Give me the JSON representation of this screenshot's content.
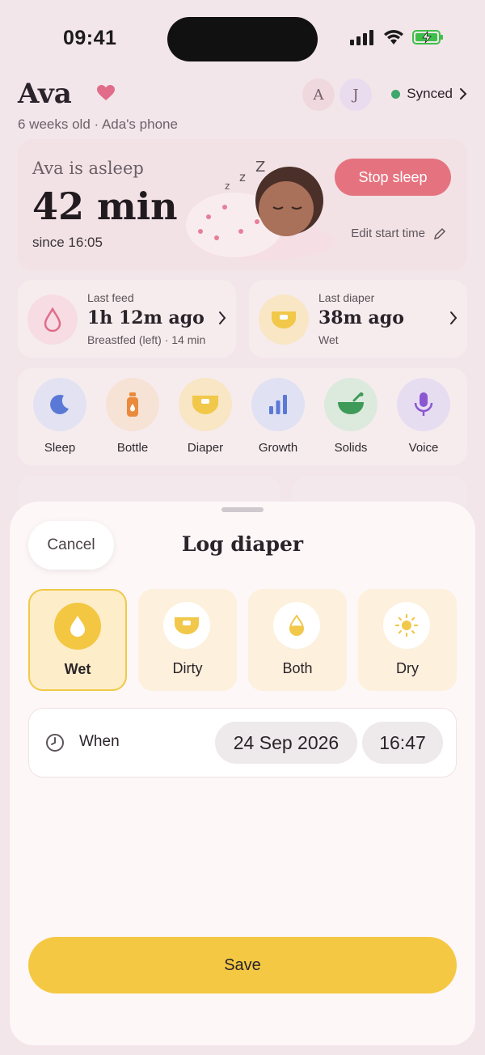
{
  "status_bar": {
    "time": "09:41"
  },
  "header": {
    "baby_name": "Ava",
    "subline": "6 weeks old · Ada's phone",
    "avatars": [
      "A",
      "J"
    ],
    "sync_label": "Synced"
  },
  "sleep_card": {
    "status": "Ava is asleep",
    "duration": "42 min",
    "since_prefix": "since",
    "since_time": "16:05",
    "stop_label": "Stop sleep",
    "edit_label": "Edit start time"
  },
  "last_feed": {
    "label": "Last feed",
    "value": "1h 12m ago",
    "detail": "Breastfed (left) · 14 min"
  },
  "last_diaper": {
    "label": "Last diaper",
    "value": "38m ago",
    "detail": "Wet"
  },
  "quick_actions": [
    {
      "label": "Sleep",
      "icon": "moon-icon"
    },
    {
      "label": "Bottle",
      "icon": "bottle-icon"
    },
    {
      "label": "Diaper",
      "icon": "diaper-icon"
    },
    {
      "label": "Growth",
      "icon": "bar-chart-icon"
    },
    {
      "label": "Solids",
      "icon": "bowl-icon"
    },
    {
      "label": "Voice",
      "icon": "microphone-icon"
    }
  ],
  "sheet": {
    "cancel_label": "Cancel",
    "title": "Log diaper",
    "types": [
      {
        "label": "Wet",
        "icon": "drop-icon",
        "selected": true
      },
      {
        "label": "Dirty",
        "icon": "diaper-icon",
        "selected": false
      },
      {
        "label": "Both",
        "icon": "half-drop-icon",
        "selected": false
      },
      {
        "label": "Dry",
        "icon": "sun-icon",
        "selected": false
      }
    ],
    "when_label": "When",
    "date": "24 Sep 2026",
    "time": "16:47",
    "save_label": "Save"
  },
  "colors": {
    "accent_yellow": "#f4c843",
    "stop_pink": "#e5737f",
    "sync_green": "#3fa76a"
  }
}
